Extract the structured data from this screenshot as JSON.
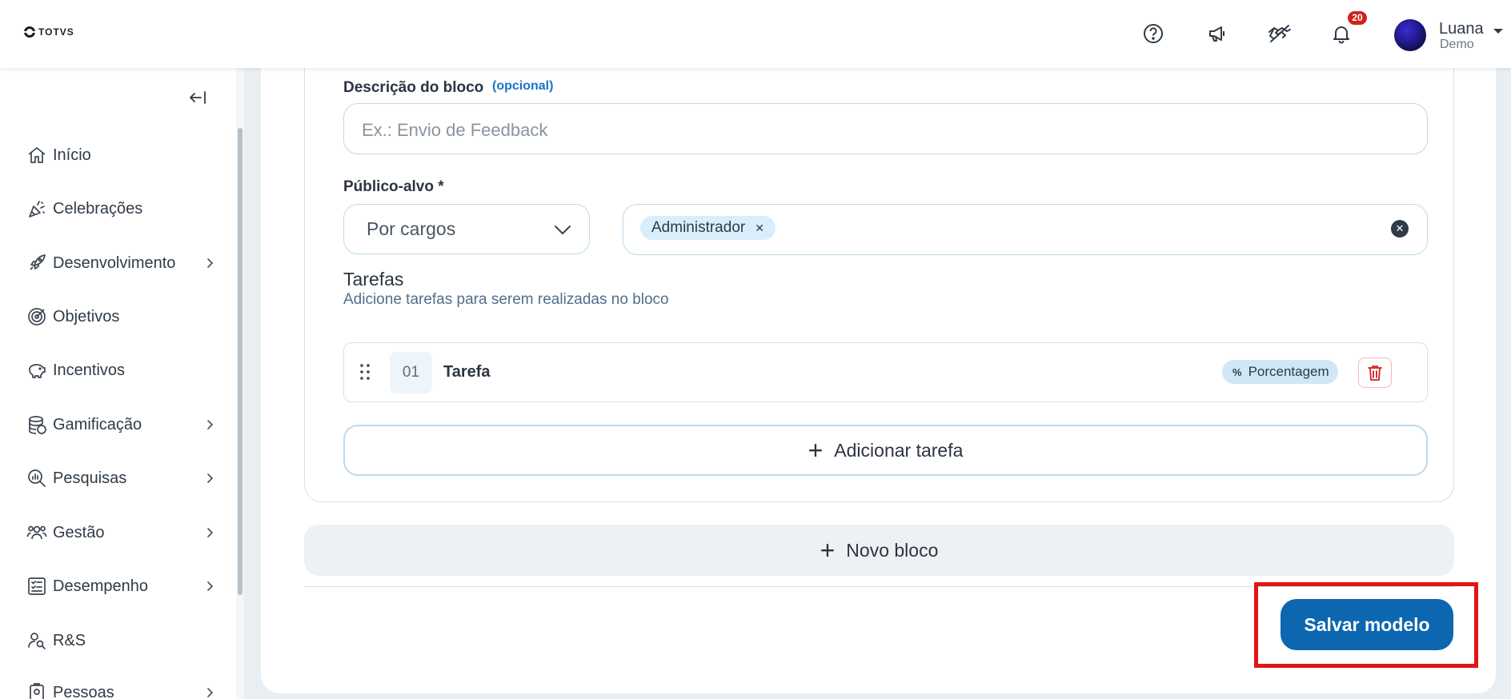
{
  "header": {
    "logo_text": "TOTVS",
    "notification_count": "20",
    "user_name": "Luana",
    "user_role": "Demo",
    "icons": [
      "help-icon",
      "megaphone-icon",
      "handshake-icon",
      "bell-icon"
    ]
  },
  "sidebar": {
    "items": [
      {
        "label": "Início",
        "icon": "home-icon",
        "has_submenu": false
      },
      {
        "label": "Celebrações",
        "icon": "party-icon",
        "has_submenu": false
      },
      {
        "label": "Desenvolvimento",
        "icon": "rocket-icon",
        "has_submenu": true
      },
      {
        "label": "Objetivos",
        "icon": "target-icon",
        "has_submenu": false
      },
      {
        "label": "Incentivos",
        "icon": "piggy-bank-icon",
        "has_submenu": false
      },
      {
        "label": "Gamificação",
        "icon": "coins-icon",
        "has_submenu": true
      },
      {
        "label": "Pesquisas",
        "icon": "search-chart-icon",
        "has_submenu": true
      },
      {
        "label": "Gestão",
        "icon": "people-icon",
        "has_submenu": true
      },
      {
        "label": "Desempenho",
        "icon": "checklist-icon",
        "has_submenu": true
      },
      {
        "label": "R&S",
        "icon": "user-search-icon",
        "has_submenu": false
      },
      {
        "label": "Pessoas",
        "icon": "badge-icon",
        "has_submenu": true
      }
    ]
  },
  "form": {
    "description_label": "Descrição do bloco",
    "description_optional": "(opcional)",
    "description_placeholder": "Ex.: Envio de Feedback",
    "audience_label": "Público-alvo *",
    "audience_type": "Por cargos",
    "audience_chips": [
      "Administrador"
    ],
    "tasks_title": "Tarefas",
    "tasks_subtitle": "Adicione tarefas para serem realizadas no bloco",
    "tasks": [
      {
        "number": "01",
        "name": "Tarefa",
        "type": "Porcentagem"
      }
    ],
    "add_task_label": "Adicionar tarefa",
    "new_block_label": "Novo bloco",
    "save_label": "Salvar modelo"
  },
  "colors": {
    "primary": "#0c66b0",
    "highlight": "#e01515",
    "danger": "#d0221c",
    "chip_bg": "#d9eefb"
  }
}
